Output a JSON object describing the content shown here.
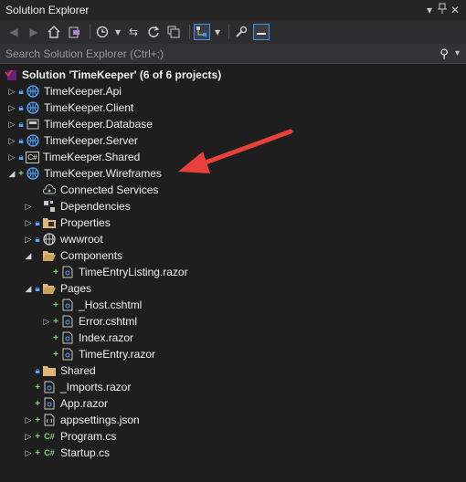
{
  "panel": {
    "title": "Solution Explorer",
    "pin_icon": "pin-icon",
    "close_icon": "close-icon"
  },
  "search": {
    "placeholder": "Search Solution Explorer (Ctrl+;)"
  },
  "solution": {
    "label": "Solution 'TimeKeeper' (6 of 6 projects)"
  },
  "projects": [
    {
      "label": "TimeKeeper.Api"
    },
    {
      "label": "TimeKeeper.Client"
    },
    {
      "label": "TimeKeeper.Database"
    },
    {
      "label": "TimeKeeper.Server"
    },
    {
      "label": "TimeKeeper.Shared"
    },
    {
      "label": "TimeKeeper.Wireframes"
    }
  ],
  "wireframes_items": {
    "connected_services": "Connected Services",
    "dependencies": "Dependencies",
    "properties": "Properties",
    "wwwroot": "wwwroot",
    "components": "Components",
    "time_entry_listing": "TimeEntryListing.razor",
    "pages": "Pages",
    "host": "_Host.cshtml",
    "error": "Error.cshtml",
    "index": "Index.razor",
    "time_entry": "TimeEntry.razor",
    "shared": "Shared",
    "imports": "_Imports.razor",
    "app": "App.razor",
    "appsettings": "appsettings.json",
    "program": "Program.cs",
    "startup": "Startup.cs"
  },
  "icon_text": {
    "csharp": "C#"
  },
  "colors": {
    "background": "#1e1e1e",
    "accent": "#3399ff",
    "arrow": "#e8403a",
    "lock": "#58a6ff",
    "added": "#7fd67f"
  }
}
